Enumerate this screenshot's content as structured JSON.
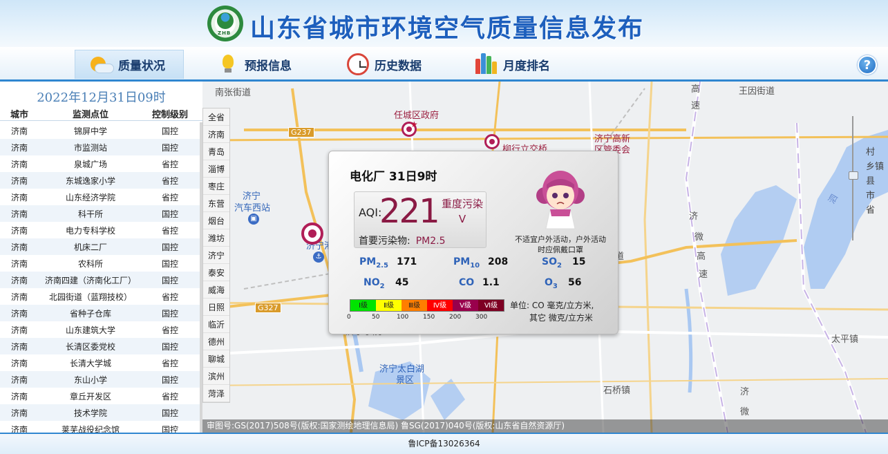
{
  "header": {
    "logo_text": "ZHB",
    "title": "山东省城市环境空气质量信息发布"
  },
  "nav": {
    "items": [
      {
        "label": "质量状况",
        "icon": "sun-cloud-icon"
      },
      {
        "label": "预报信息",
        "icon": "light-bulb-icon"
      },
      {
        "label": "历史数据",
        "icon": "clock-icon"
      },
      {
        "label": "月度排名",
        "icon": "bar-chart-icon"
      }
    ],
    "help": "?"
  },
  "left": {
    "date_title": "2022年12月31日09时",
    "headers": {
      "city": "城市",
      "site": "监测点位",
      "level": "控制级别"
    },
    "rows": [
      {
        "city": "济南",
        "site": "锦屏中学",
        "level": "国控"
      },
      {
        "city": "济南",
        "site": "市监测站",
        "level": "国控"
      },
      {
        "city": "济南",
        "site": "泉城广场",
        "level": "省控"
      },
      {
        "city": "济南",
        "site": "东城逸家小学",
        "level": "省控"
      },
      {
        "city": "济南",
        "site": "山东经济学院",
        "level": "省控"
      },
      {
        "city": "济南",
        "site": "科干所",
        "level": "国控"
      },
      {
        "city": "济南",
        "site": "电力专科学校",
        "level": "省控"
      },
      {
        "city": "济南",
        "site": "机床二厂",
        "level": "国控"
      },
      {
        "city": "济南",
        "site": "农科所",
        "level": "国控"
      },
      {
        "city": "济南",
        "site": "济南四建（济南化工厂）",
        "level": "国控"
      },
      {
        "city": "济南",
        "site": "北园街道（蓝翔技校）",
        "level": "省控"
      },
      {
        "city": "济南",
        "site": "省种子仓库",
        "level": "国控"
      },
      {
        "city": "济南",
        "site": "山东建筑大学",
        "level": "省控"
      },
      {
        "city": "济南",
        "site": "长清区委党校",
        "level": "国控"
      },
      {
        "city": "济南",
        "site": "长清大学城",
        "level": "省控"
      },
      {
        "city": "济南",
        "site": "东山小学",
        "level": "国控"
      },
      {
        "city": "济南",
        "site": "章丘开发区",
        "level": "省控"
      },
      {
        "city": "济南",
        "site": "技术学院",
        "level": "国控"
      },
      {
        "city": "济南",
        "site": "莱芜战役纪念馆",
        "level": "国控"
      }
    ]
  },
  "map": {
    "cities": [
      "全省",
      "济南",
      "青岛",
      "淄博",
      "枣庄",
      "东营",
      "烟台",
      "潍坊",
      "济宁",
      "泰安",
      "威海",
      "日照",
      "临沂",
      "德州",
      "聊城",
      "滨州",
      "菏泽"
    ],
    "labels": {
      "nanzhang": "南张街道",
      "wangyin": "王因街道",
      "rencheng": "任城区政府",
      "liuhang": "柳行立交桥",
      "gaoxin": "济宁高新区管委会",
      "station_a": "济宁",
      "station_b": "汽车西站",
      "jininggang": "济宁港",
      "jiedao": "街道",
      "taiping": "太平镇",
      "shiqiao": "石桥镇",
      "taibaihu_a": "济宁太白湖",
      "taibaihu_b": "景区",
      "gao": "高",
      "su": "速",
      "ji_wei_gao_su": [
        "济",
        "微",
        "高",
        "速"
      ],
      "ji_wei": [
        "济",
        "微"
      ],
      "si": "泗",
      "g237": "G237",
      "g327": "G327",
      "partial": "济宁学院"
    },
    "zoom_labels": [
      "村",
      "乡镇",
      "县",
      "市",
      "省"
    ],
    "copyright": "审图号:GS(2017)508号(版权:国家测绘地理信息局) 鲁SG(2017)040号(版权:山东省自然资源厅)"
  },
  "popup": {
    "title": "电化厂  31日9时",
    "aqi_label": "AQI:",
    "aqi": "221",
    "level_text": "重度污染",
    "level_roman": "Ⅴ",
    "primary_label": "首要污染物:",
    "primary_value": "PM2.5",
    "advice": "不适宜户外活动，户外活动时应佩戴口罩",
    "pollutants": {
      "pm25": {
        "name": "PM",
        "sub": "2.5",
        "value": "171"
      },
      "pm10": {
        "name": "PM",
        "sub": "10",
        "value": "208"
      },
      "so2": {
        "name": "SO",
        "sub": "2",
        "value": "15"
      },
      "no2": {
        "name": "NO",
        "sub": "2",
        "value": "45"
      },
      "co": {
        "name": "CO",
        "sub": "",
        "value": "1.1"
      },
      "o3": {
        "name": "O",
        "sub": "3",
        "value": "56"
      }
    },
    "scale_levels": [
      {
        "label": "Ⅰ级",
        "color": "#00e400"
      },
      {
        "label": "Ⅱ级",
        "color": "#ffff00"
      },
      {
        "label": "Ⅲ级",
        "color": "#ff7e00"
      },
      {
        "label": "Ⅳ级",
        "color": "#ff0000"
      },
      {
        "label": "Ⅴ级",
        "color": "#99004c"
      },
      {
        "label": "Ⅵ级",
        "color": "#7e0023"
      }
    ],
    "scale_ticks": [
      "0",
      "50",
      "100",
      "150",
      "200",
      "300"
    ],
    "unit_line1": "单位: CO 毫克/立方米,",
    "unit_line2": "其它 微克/立方米"
  },
  "footer": {
    "icp": "鲁ICP备13026364"
  }
}
